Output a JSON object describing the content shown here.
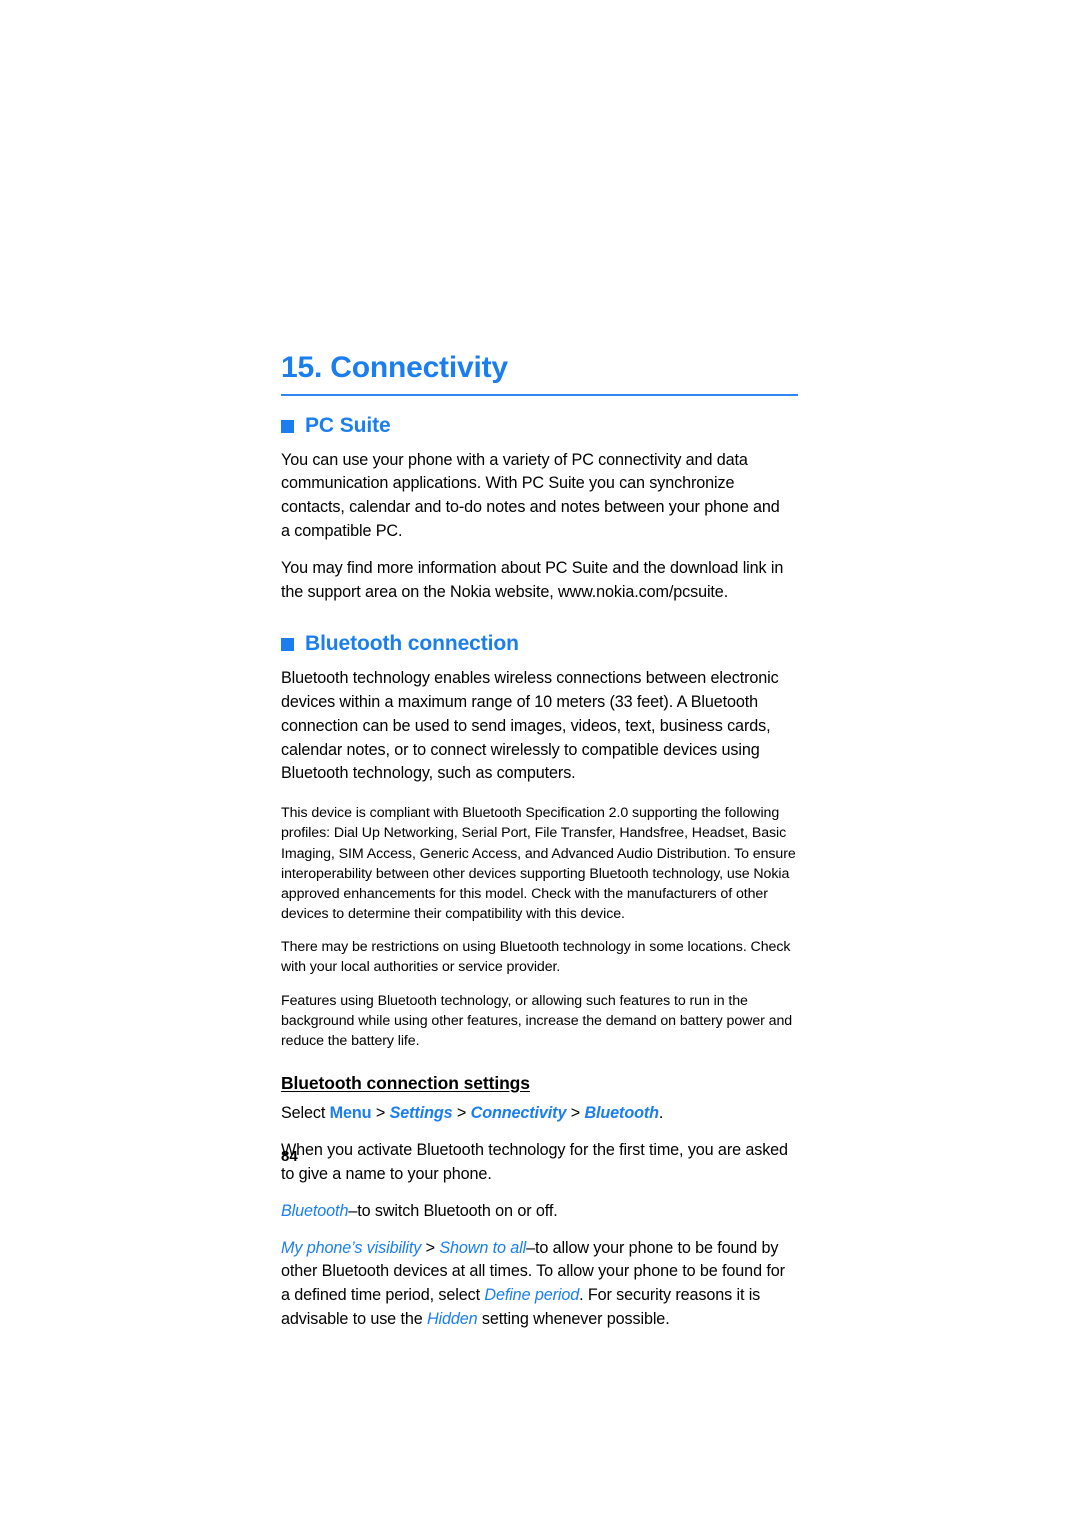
{
  "chapter": {
    "title": "15. Connectivity"
  },
  "sections": {
    "pc_suite": {
      "heading": "PC Suite",
      "paragraph_1": "You can use your phone with a variety of PC connectivity and data communication applications. With PC Suite you can synchronize contacts, calendar and to-do notes and notes between your phone and a compatible PC.",
      "paragraph_2": "You may find more information about PC Suite and the download link in the support area on the Nokia website, www.nokia.com/pcsuite."
    },
    "bluetooth": {
      "heading": "Bluetooth connection",
      "paragraph_1": "Bluetooth technology enables wireless connections between electronic devices within a maximum range of 10 meters (33 feet). A Bluetooth connection can be used to send images, videos, text, business cards, calendar notes, or to connect wirelessly to compatible devices using Bluetooth technology, such as computers.",
      "note_1": "This device is compliant with Bluetooth Specification 2.0 supporting the following profiles: Dial Up Networking, Serial Port, File Transfer, Handsfree, Headset, Basic Imaging, SIM Access, Generic Access, and Advanced Audio Distribution. To ensure interoperability between other devices supporting Bluetooth technology, use Nokia approved enhancements for this model. Check with the manufacturers of other devices to determine their compatibility with this device.",
      "note_2": "There may be restrictions on using Bluetooth technology in some locations. Check with your local authorities or service provider.",
      "note_3": "Features using Bluetooth technology, or allowing such features to run in the background while using other features, increase the demand on battery power and reduce the battery life.",
      "settings": {
        "heading": "Bluetooth connection settings",
        "select_label": "Select",
        "menu_item": "Menu",
        "path_settings": "Settings",
        "path_connectivity": "Connectivity",
        "path_bluetooth": "Bluetooth",
        "separator": ">",
        "period": ".",
        "paragraph_activate": "When you activate Bluetooth technology for the first time, you are asked to give a name to your phone.",
        "option_bluetooth_term": "Bluetooth",
        "option_bluetooth_desc": "–to switch Bluetooth on or off.",
        "visibility_term": "My phone’s visibility",
        "visibility_value": "Shown to all",
        "visibility_desc_1": "–to allow your phone to be found by other Bluetooth devices at all times. To allow your phone to be found for a defined time period, select ",
        "define_period_term": "Define period",
        "visibility_desc_2": ". For security reasons it is advisable to use the ",
        "hidden_term": "Hidden",
        "visibility_desc_3": " setting whenever possible."
      }
    }
  },
  "footer": {
    "page_number": "84"
  },
  "colors": {
    "accent_blue": "#1a7ef0",
    "rule_blue": "#2f86f5",
    "text_black": "#000000"
  }
}
